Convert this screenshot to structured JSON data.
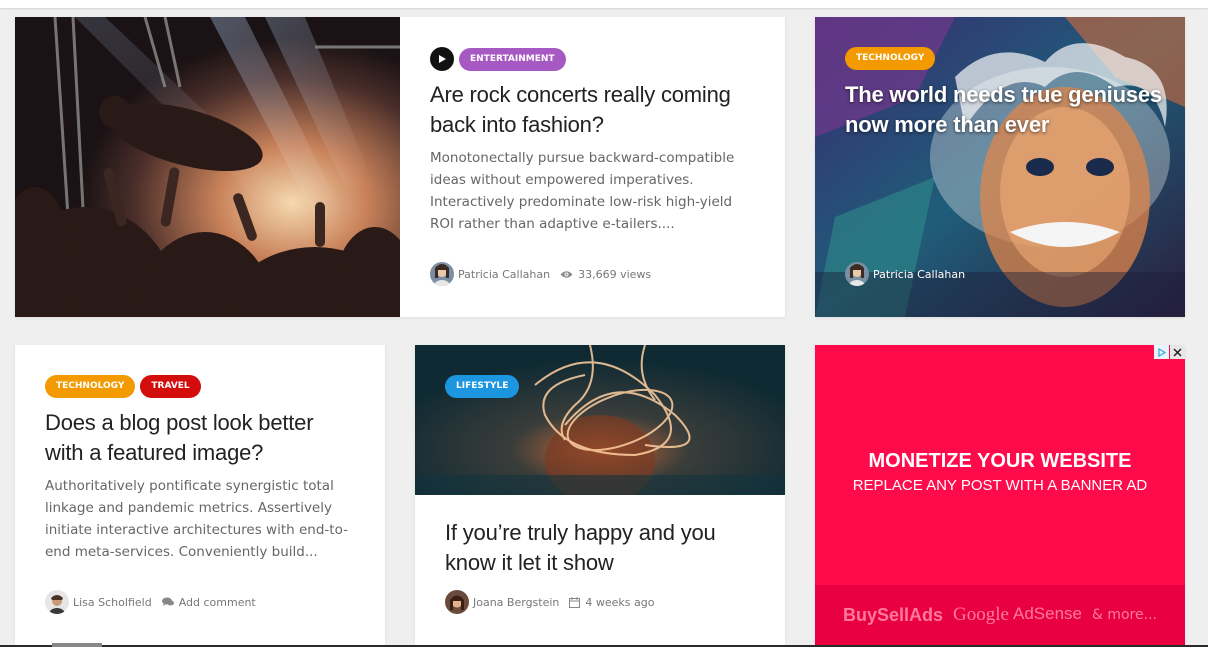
{
  "posts": [
    {
      "category_labels": [
        "ENTERTAINMENT"
      ],
      "title": "Are rock concerts really coming back into fashion?",
      "excerpt": "Monotonectally pursue backward-compatible ideas without empowered imperatives. Interactively predominate low-risk high-yield ROI rather than adaptive e-tailers....",
      "author": "Patricia Callahan",
      "views": "33,669 views",
      "icon": "play-icon"
    },
    {
      "category_labels": [
        "TECHNOLOGY"
      ],
      "title": "The world needs true geniuses now more than ever",
      "author": "Patricia Callahan"
    },
    {
      "category_labels": [
        "TECHNOLOGY",
        "TRAVEL"
      ],
      "title": "Does a blog post look better with a featured image?",
      "excerpt": "Authoritatively pontificate synergistic total linkage and pandemic metrics. Assertively initiate interactive architectures with end-to-end meta-services. Conveniently build...",
      "author": "Lisa Scholfield",
      "comments": "Add comment"
    },
    {
      "category_labels": [
        "LIFESTYLE"
      ],
      "title": "If you’re truly happy and you know it let it show",
      "author": "Joana Bergstein",
      "date": "4 weeks ago"
    }
  ],
  "ad": {
    "headline": "MONETIZE YOUR WEBSITE",
    "subline": "REPLACE ANY POST WITH A BANNER AD",
    "networks": [
      "BuySellAds",
      "Google",
      "AdSense",
      "& more..."
    ],
    "background": "#ff0a4a",
    "footer_background": "#e80040"
  },
  "colors": {
    "entertainment": "#a659c2",
    "technology": "#f29a00",
    "travel": "#d30c0c",
    "lifestyle": "#1d96e0"
  }
}
